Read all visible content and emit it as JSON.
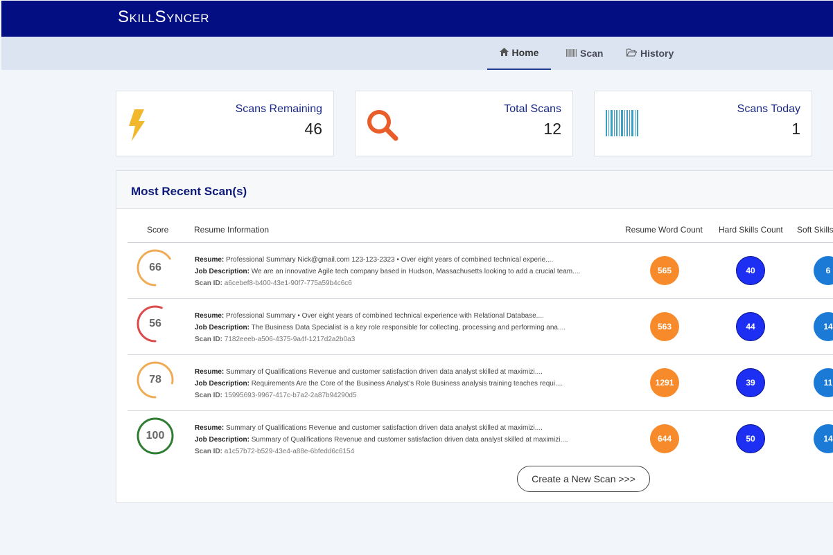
{
  "brand": "SkillSyncer",
  "nav": {
    "home": "Home",
    "scan": "Scan",
    "history": "History"
  },
  "stats": [
    {
      "label": "Scans Remaining",
      "value": "46",
      "icon": "lightning-icon",
      "color": "#f1b82e"
    },
    {
      "label": "Total Scans",
      "value": "12",
      "icon": "search-icon",
      "color": "#e85d2a"
    },
    {
      "label": "Scans Today",
      "value": "1",
      "icon": "barcode-icon",
      "color": "#3aa0c6"
    }
  ],
  "panel": {
    "title": "Most Recent Scan(s)",
    "headers": {
      "score": "Score",
      "info": "Resume Information",
      "word_count": "Resume Word Count",
      "hard_skills": "Hard Skills Count",
      "soft_skills": "Soft Skills"
    },
    "labels": {
      "resume": "Resume:",
      "job": "Job Description:",
      "scan_id": "Scan ID:"
    },
    "rows": [
      {
        "score": "66",
        "score_color": "#f0ac55",
        "score_fraction": 0.66,
        "resume": "Professional Summary Nick@gmail.com 123-123-2323 • Over eight years of combined technical experie....",
        "job": "We are an innovative Agile tech company based in Hudson, Massachusetts looking to add a crucial team....",
        "scan_id": "a6cebef8-b400-43e1-90f7-775a59b4c6c6",
        "word_count": "565",
        "hard_skills": "40",
        "soft_skills": "6"
      },
      {
        "score": "56",
        "score_color": "#dc4a4a",
        "score_fraction": 0.56,
        "resume": "Professional Summary • Over eight years of combined technical experience with Relational Database....",
        "job": "The Business Data Specialist is a key role responsible for collecting, processing and performing ana....",
        "scan_id": "7182eeeb-a506-4375-9a4f-1217d2a2b0a3",
        "word_count": "563",
        "hard_skills": "44",
        "soft_skills": "14"
      },
      {
        "score": "78",
        "score_color": "#f0ac55",
        "score_fraction": 0.78,
        "resume": "Summary of Qualifications Revenue and customer satisfaction driven data analyst skilled at maximizi....",
        "job": "Requirements Are the Core of the Business Analyst’s Role Business analysis training teaches requi....",
        "scan_id": "15995693-9967-417c-b7a2-2a87b94290d5",
        "word_count": "1291",
        "hard_skills": "39",
        "soft_skills": "11"
      },
      {
        "score": "100",
        "score_color": "#2e7d32",
        "score_fraction": 1.0,
        "resume": "Summary of Qualifications Revenue and customer satisfaction driven data analyst skilled at maximizi....",
        "job": "Summary of Qualifications Revenue and customer satisfaction driven data analyst skilled at maximizi....",
        "scan_id": "a1c57b72-b529-43e4-a88e-6bfedd6c6154",
        "word_count": "644",
        "hard_skills": "50",
        "soft_skills": "14"
      }
    ],
    "cta": "Create a New Scan >>>"
  }
}
